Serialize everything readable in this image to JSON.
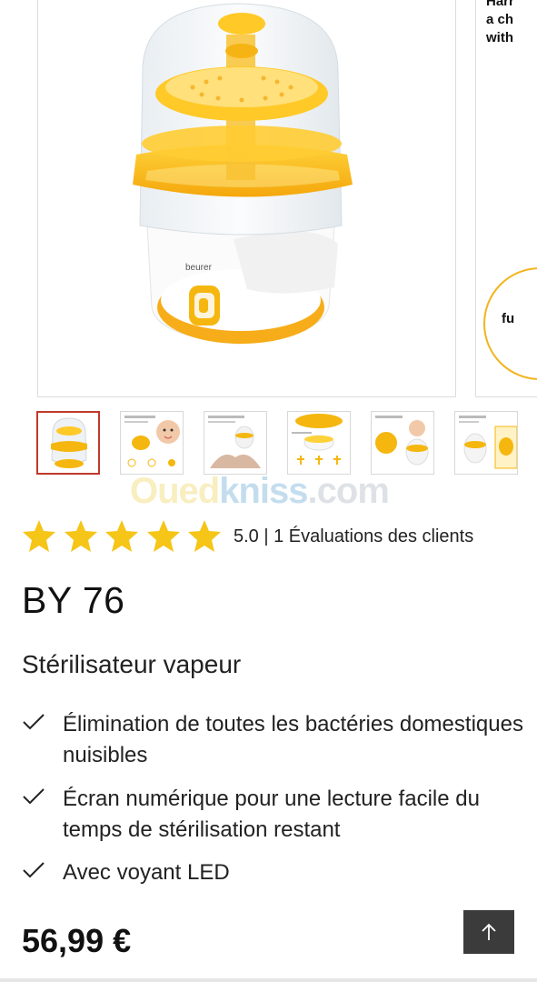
{
  "gallery": {
    "next_slide_text": "Harr\na ch\nwith",
    "next_slide_badge": "fu",
    "product_brand": "beurer",
    "thumbnails": [
      {
        "label": "Steam sterilizer view",
        "selected": true
      },
      {
        "label": "Baby image"
      },
      {
        "label": "Sterilizer usage"
      },
      {
        "label": "Sterilizer parts"
      },
      {
        "label": "Sterilizer detail"
      },
      {
        "label": "Sterilizer packaging"
      }
    ]
  },
  "watermark": {
    "part1": "Oued",
    "part2": "kniss",
    "part3": ".com"
  },
  "rating": {
    "value": 5,
    "max": 5,
    "text": "5.0 | 1 Évaluations des clients",
    "star_color": "#f5c518"
  },
  "product": {
    "model": "BY 76",
    "subtitle": "Stérilisateur vapeur",
    "features": [
      "Élimination de toutes les bactéries domestiques nuisibles",
      "Écran numérique pour une lecture facile du temps de stérilisation restant",
      "Avec voyant LED"
    ],
    "price": "56,99 €"
  },
  "icons": {
    "check": "check-icon",
    "back_to_top": "arrow-up-icon",
    "star": "star-icon"
  },
  "colors": {
    "accent_yellow": "#f5b70f",
    "button_dark": "#3b3b3b"
  }
}
